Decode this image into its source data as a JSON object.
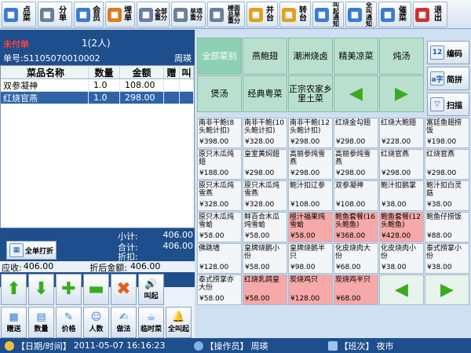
{
  "toolbar": [
    {
      "name": "order-dish-button",
      "label": "点\n菜",
      "icon": "menu-book-icon",
      "color": "#3a7bd5",
      "small": false
    },
    {
      "name": "split-bill-button",
      "label": "分\n单",
      "icon": "printer-icon",
      "color": "#6a7f99",
      "small": false
    },
    {
      "name": "member-button",
      "label": "会\n员",
      "icon": "member-card-icon",
      "color": "#3a7bd5",
      "small": false
    },
    {
      "name": "pay-bill-button",
      "label": "埋\n单",
      "icon": "checkout-icon",
      "color": "#e07a20",
      "small": false
    },
    {
      "name": "all-reprint-button",
      "label": "全部\n重分",
      "icon": "reprint-icon",
      "color": "#6a7f99",
      "small": true
    },
    {
      "name": "single-reprint-button",
      "label": "单项\n重分",
      "icon": "single-reprint-icon",
      "color": "#6a7f99",
      "small": true
    },
    {
      "name": "reprint-station-button",
      "label": "楼面\n总单\n重分",
      "icon": "floor-reprint-icon",
      "color": "#6a7f99",
      "small": true
    },
    {
      "name": "merge-table-button",
      "label": "并\n台",
      "icon": "merge-icon",
      "color": "#e0a020",
      "small": false
    },
    {
      "name": "transfer-table-button",
      "label": "转\n台",
      "icon": "transfer-icon",
      "color": "#e0a020",
      "small": false
    },
    {
      "name": "call-notify-button",
      "label": "叫起\n通知",
      "icon": "bell-icon",
      "color": "#3a7bd5",
      "small": true
    },
    {
      "name": "all-call-notify-button",
      "label": "全叫\n通知",
      "icon": "phone-icon",
      "color": "#3a7bd5",
      "small": true
    },
    {
      "name": "rush-dish-button",
      "label": "催\n菜",
      "icon": "rush-icon",
      "color": "#3a7bd5",
      "small": false
    },
    {
      "name": "exit-button",
      "label": "退\n出",
      "icon": "exit-icon",
      "color": "#d03030",
      "small": false
    }
  ],
  "order": {
    "status": "未付单",
    "guests": "1(2人)",
    "number": "单号:S1105070010002",
    "waiter": "周瑛"
  },
  "table": {
    "headers": [
      "菜品名称",
      "数量",
      "金额",
      "赠",
      "叫"
    ],
    "rows": [
      {
        "name": "双参凝神",
        "qty": "1.0",
        "amount": "108.00",
        "gift": "",
        "call": ""
      },
      {
        "name": "红烧官燕",
        "qty": "1.0",
        "amount": "298.00",
        "gift": "",
        "call": ""
      }
    ]
  },
  "summary": {
    "subtotal_label": "小计:",
    "subtotal": "406.00",
    "total_label": "合计:",
    "total": "406.00",
    "discount_label": "折扣:",
    "discount": "",
    "full_discount_btn": "全单打折",
    "due_label": "应收:",
    "due": "406.00",
    "after_label": "折后金额:",
    "after": "406.00"
  },
  "controls": [
    {
      "name": "arrow-up-button",
      "label": "",
      "glyph": "⬆",
      "icon": "arrow-up-icon",
      "color": "#3aaa1e"
    },
    {
      "name": "arrow-down-button",
      "label": "",
      "glyph": "⬇",
      "icon": "arrow-down-icon",
      "color": "#3aaa1e"
    },
    {
      "name": "add-button",
      "label": "",
      "glyph": "✚",
      "icon": "plus-icon",
      "color": "#3aaa1e"
    },
    {
      "name": "minus-button",
      "label": "",
      "glyph": "▬",
      "icon": "minus-icon",
      "color": "#3aaa1e"
    },
    {
      "name": "delete-button",
      "label": "",
      "glyph": "✖",
      "icon": "delete-icon",
      "color": "#e85a1a"
    },
    {
      "name": "call-button",
      "label": "叫起",
      "glyph": "🔊",
      "icon": "speaker-icon",
      "color": "#4a6a8a"
    },
    {
      "name": "gift-button",
      "label": "赠送",
      "glyph": "▦",
      "icon": "gift-icon",
      "color": "#3a7bd5"
    },
    {
      "name": "quantity-button",
      "label": "数量",
      "glyph": "▤",
      "icon": "quantity-icon",
      "color": "#3a7bd5"
    },
    {
      "name": "price-button",
      "label": "价格",
      "glyph": "✎",
      "icon": "price-icon",
      "color": "#3a7bd5"
    },
    {
      "name": "persons-button",
      "label": "人数",
      "glyph": "☺",
      "icon": "persons-icon",
      "color": "#3a7bd5"
    },
    {
      "name": "method-button",
      "label": "做法",
      "glyph": "✍",
      "icon": "method-icon",
      "color": "#3a7bd5"
    },
    {
      "name": "temp-dish-button",
      "label": "临时菜",
      "glyph": "☕",
      "icon": "temp-dish-icon",
      "color": "#3a7bd5"
    },
    {
      "name": "all-call-button",
      "label": "全叫起",
      "glyph": "🔔",
      "icon": "all-call-icon",
      "color": "#4a6a8a"
    }
  ],
  "categories": [
    {
      "label": "全部菜别",
      "active": true
    },
    {
      "label": "燕鲍翅",
      "active": false
    },
    {
      "label": "潮洲烧卤",
      "active": false
    },
    {
      "label": "精美凉菜",
      "active": false
    },
    {
      "label": "炖汤",
      "active": false
    },
    {
      "label": "煲汤",
      "active": false
    },
    {
      "label": "经典粤菜",
      "active": false
    },
    {
      "label": "正宗农家乡里土菜",
      "active": false
    }
  ],
  "side_buttons": [
    {
      "name": "code-button",
      "label": "编码",
      "icon": "code-icon",
      "glyph": "12"
    },
    {
      "name": "pinyin-button",
      "label": "简拼",
      "icon": "pinyin-icon",
      "glyph": "a字"
    },
    {
      "name": "scan-button",
      "label": "扫描",
      "icon": "filter-icon",
      "glyph": "▽"
    }
  ],
  "dishes": [
    {
      "name": "南非干鲍(8头鲍计扣)",
      "price": "¥398.00",
      "pink": false
    },
    {
      "name": "南非干鲍(10头鲍计扣)",
      "price": "¥328.00",
      "pink": false
    },
    {
      "name": "南非干鲍(12头鲍计扣)",
      "price": "¥298.00",
      "pink": false
    },
    {
      "name": "红烧金勾翅",
      "price": "¥298.00",
      "pink": false
    },
    {
      "name": "红烧大鲍翅",
      "price": "¥228.00",
      "pink": false
    },
    {
      "name": "富廷鱼翅捞饭",
      "price": "¥198.00",
      "pink": false
    },
    {
      "name": "原只木瓜炖翅",
      "price": "¥188.00",
      "pink": false
    },
    {
      "name": "皇室黄焖翅",
      "price": "¥298.00",
      "pink": false
    },
    {
      "name": "高丽参炖雪燕",
      "price": "¥298.00",
      "pink": false
    },
    {
      "name": "高丽参炖雪燕",
      "price": "¥298.00",
      "pink": false
    },
    {
      "name": "红烧官燕",
      "price": "¥298.00",
      "pink": false
    },
    {
      "name": "红烧官燕",
      "price": "¥298.00",
      "pink": false
    },
    {
      "name": "原只木瓜炖雪燕",
      "price": "¥328.00",
      "pink": false
    },
    {
      "name": "原只木瓜炖雪燕",
      "price": "¥328.00",
      "pink": false
    },
    {
      "name": "鲍汁扣辽参",
      "price": "¥108.00",
      "pink": false
    },
    {
      "name": "双参凝神",
      "price": "¥108.00",
      "pink": false
    },
    {
      "name": "鲍汁扣鹅掌",
      "price": "¥38.00",
      "pink": false
    },
    {
      "name": "鲍汁扣白灵菇",
      "price": "¥38.00",
      "pink": false
    },
    {
      "name": "原只木瓜炖雪蛤",
      "price": "¥58.00",
      "pink": false
    },
    {
      "name": "鲜百合木瓜炖雪蛤",
      "price": "¥58.00",
      "pink": false
    },
    {
      "name": "極汁福果炖雪蛤",
      "price": "¥58.00",
      "pink": true
    },
    {
      "name": "鲍鱼套餐(16头鲍鱼)",
      "price": "¥368.00",
      "pink": true
    },
    {
      "name": "鲍鱼套餐(12头鲍鱼)",
      "price": "¥428.00",
      "pink": true
    },
    {
      "name": "鲍鱼仔捞饭",
      "price": "¥88.00",
      "pink": false
    },
    {
      "name": "佛跳墙",
      "price": "¥128.00",
      "pink": false
    },
    {
      "name": "皇牌烧鹅小份",
      "price": "¥58.00",
      "pink": false
    },
    {
      "name": "皇牌烧鹅半只",
      "price": "¥98.00",
      "pink": false
    },
    {
      "name": "化皮烧肉大份",
      "price": "¥68.00",
      "pink": false
    },
    {
      "name": "化皮烧肉小份",
      "price": "¥38.00",
      "pink": false
    },
    {
      "name": "泰式捞掌小份",
      "price": "¥38.00",
      "pink": false
    },
    {
      "name": "泰式捞掌亦大份",
      "price": "¥58.00",
      "pink": false
    },
    {
      "name": "红烧乳鸽皇",
      "price": "¥58.00",
      "pink": true
    },
    {
      "name": "炭烧鸡只",
      "price": "¥128.00",
      "pink": true
    },
    {
      "name": "炭烧鸡半只",
      "price": "¥68.00",
      "pink": true
    }
  ],
  "statusbar": {
    "datetime_label": "【日期/时间】",
    "datetime": "2011-05-07  16:16:23",
    "operator_label": "【操作员】",
    "operator": "周瑛",
    "shift_label": "【班次】",
    "shift": "夜市"
  }
}
